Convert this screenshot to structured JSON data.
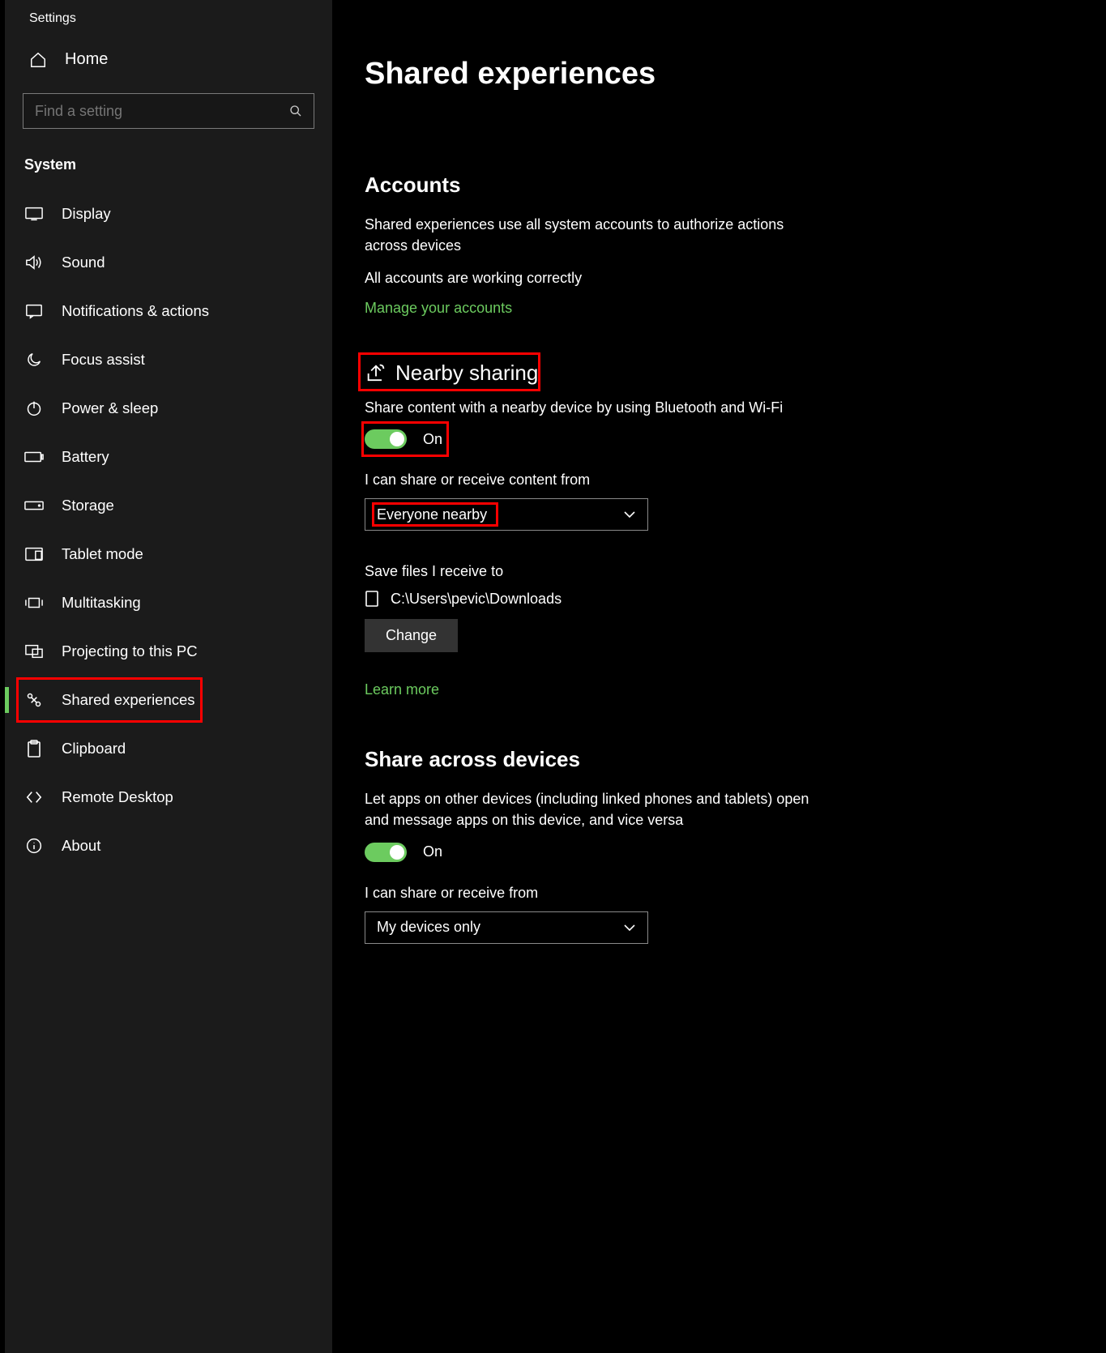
{
  "window_title": "Settings",
  "home_label": "Home",
  "search_placeholder": "Find a setting",
  "category": "System",
  "sidebar": {
    "items": [
      {
        "label": "Display"
      },
      {
        "label": "Sound"
      },
      {
        "label": "Notifications & actions"
      },
      {
        "label": "Focus assist"
      },
      {
        "label": "Power & sleep"
      },
      {
        "label": "Battery"
      },
      {
        "label": "Storage"
      },
      {
        "label": "Tablet mode"
      },
      {
        "label": "Multitasking"
      },
      {
        "label": "Projecting to this PC"
      },
      {
        "label": "Shared experiences"
      },
      {
        "label": "Clipboard"
      },
      {
        "label": "Remote Desktop"
      },
      {
        "label": "About"
      }
    ]
  },
  "page": {
    "title": "Shared experiences",
    "accounts": {
      "heading": "Accounts",
      "body1": "Shared experiences use all system accounts to authorize actions across devices",
      "body2": "All accounts are working correctly",
      "link": "Manage your accounts"
    },
    "nearby": {
      "heading": "Nearby sharing",
      "body": "Share content with a nearby device by using Bluetooth and Wi-Fi",
      "toggle_state": "On",
      "receive_label": "I can share or receive content from",
      "receive_value": "Everyone nearby",
      "save_label": "Save files I receive to",
      "save_path": "C:\\Users\\pevic\\Downloads",
      "change_button": "Change",
      "learn_link": "Learn more"
    },
    "across": {
      "heading": "Share across devices",
      "body": "Let apps on other devices (including linked phones and tablets) open and message apps on this device, and vice versa",
      "toggle_state": "On",
      "receive_label": "I can share or receive from",
      "receive_value": "My devices only"
    }
  }
}
